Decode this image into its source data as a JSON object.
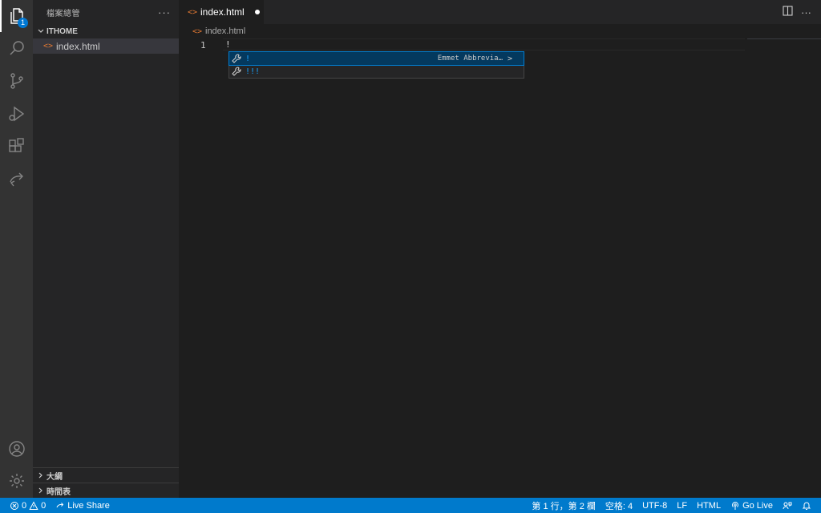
{
  "sidebar": {
    "title": "檔案總管",
    "more": "···",
    "folder": "ITHOME",
    "files": [
      {
        "name": "index.html",
        "icon": "<>"
      }
    ],
    "outline": "大綱",
    "timeline": "時間表"
  },
  "activity": {
    "explorer_badge": "1"
  },
  "tabs": [
    {
      "label": "index.html",
      "icon": "<>",
      "dirty": true
    }
  ],
  "tab_actions": {
    "more": "···"
  },
  "breadcrumb": {
    "icon": "<>",
    "file": "index.html"
  },
  "editor": {
    "line_numbers": [
      "1"
    ],
    "lines": [
      "!"
    ]
  },
  "suggestions": [
    {
      "label": "!",
      "detail": "Emmet Abbrevia…",
      "more": ">",
      "selected": true
    },
    {
      "label": "!!!",
      "detail": "",
      "more": "",
      "selected": false
    }
  ],
  "statusbar": {
    "errors": "0",
    "warnings": "0",
    "live_share": "Live Share",
    "position": "第 1 行，第 2 欄",
    "indent": "空格: 4",
    "encoding": "UTF-8",
    "eol": "LF",
    "language": "HTML",
    "go_live": "Go Live"
  },
  "colors": {
    "accent": "#007acc",
    "activitybar": "#333333",
    "sidebar": "#252526",
    "editor": "#1e1e1e",
    "html_icon": "#e37933",
    "suggest_label": "#18a3ff"
  }
}
